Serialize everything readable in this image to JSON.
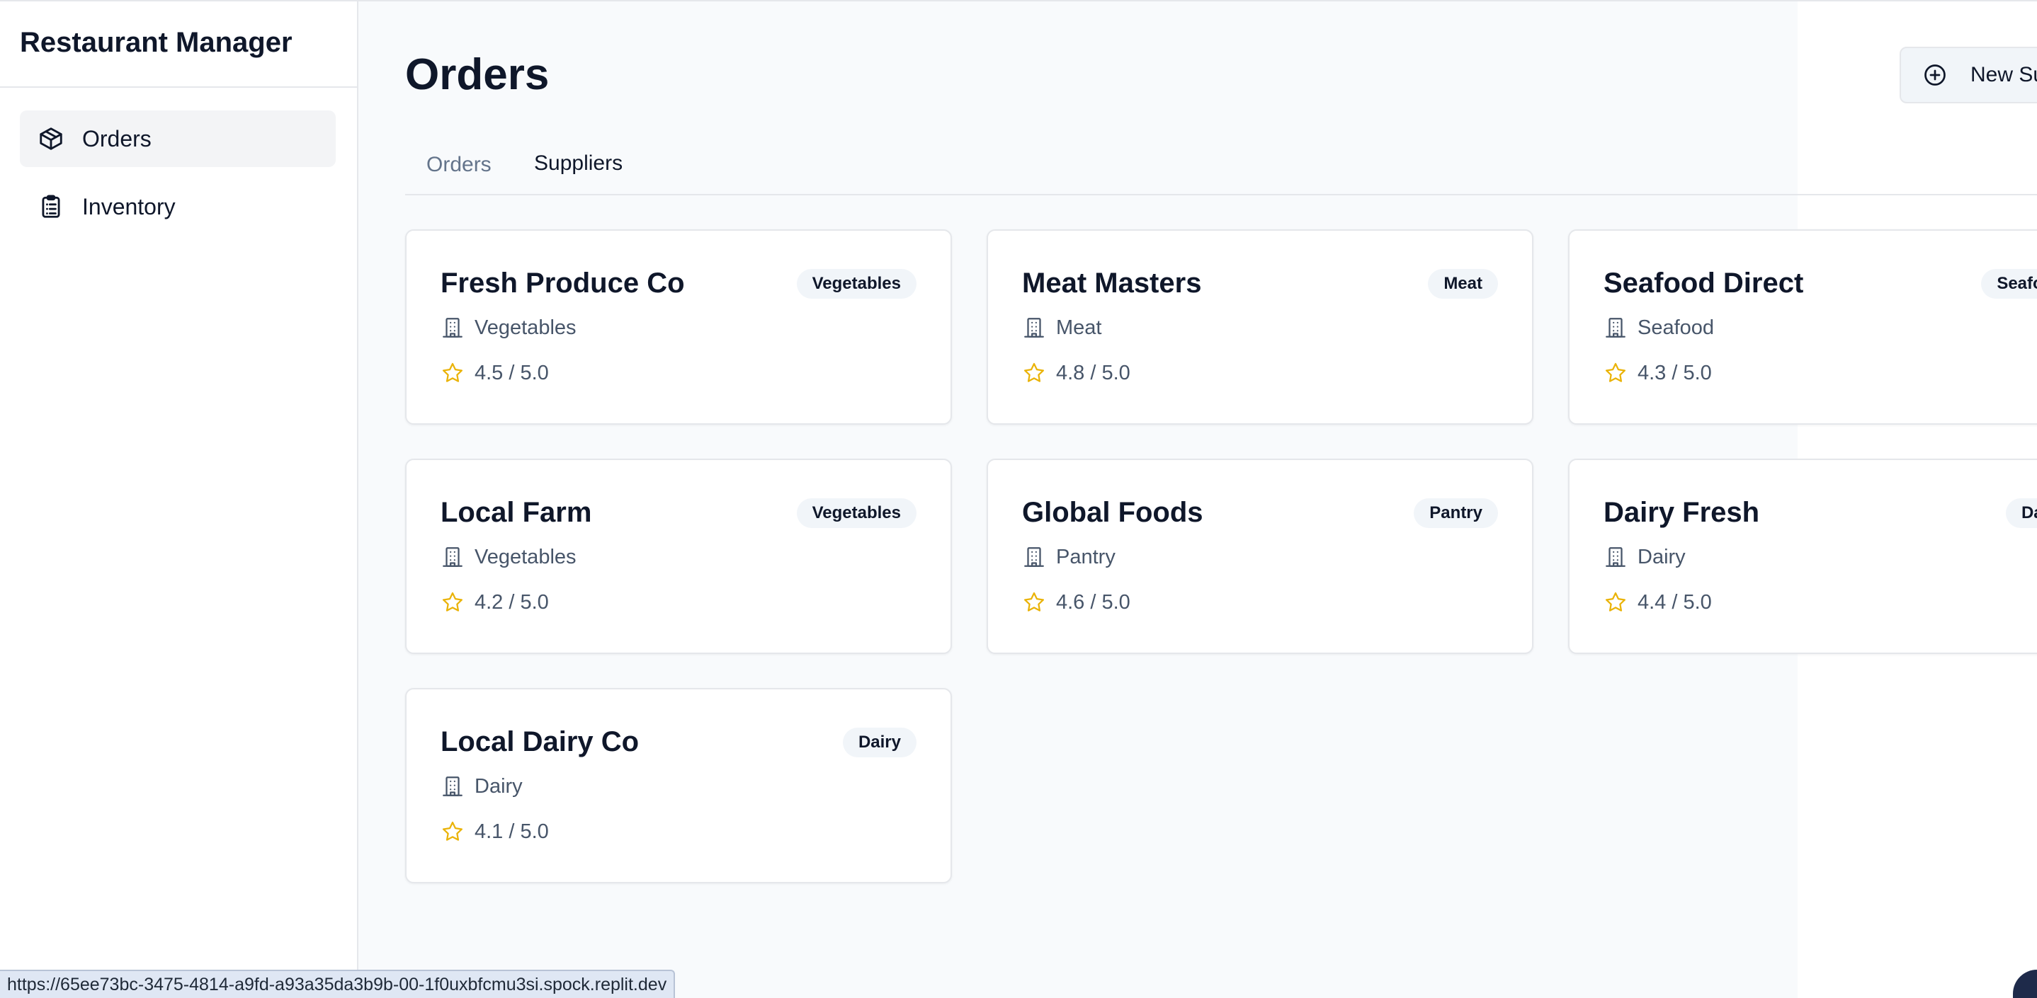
{
  "app": {
    "title": "Restaurant Manager"
  },
  "sidebar": {
    "items": [
      {
        "label": "Orders",
        "icon": "package-icon",
        "active": true
      },
      {
        "label": "Inventory",
        "icon": "clipboard-list-icon",
        "active": false
      }
    ]
  },
  "header": {
    "title": "Orders",
    "new_supplier_label": "New Supplier"
  },
  "tabs": [
    {
      "label": "Orders",
      "active": false
    },
    {
      "label": "Suppliers",
      "active": true
    }
  ],
  "suppliers": [
    {
      "name": "Fresh Produce Co",
      "badge": "Vegetables",
      "category": "Vegetables",
      "rating": "4.5 / 5.0"
    },
    {
      "name": "Meat Masters",
      "badge": "Meat",
      "category": "Meat",
      "rating": "4.8 / 5.0"
    },
    {
      "name": "Seafood Direct",
      "badge": "Seafood",
      "category": "Seafood",
      "rating": "4.3 / 5.0"
    },
    {
      "name": "Local Farm",
      "badge": "Vegetables",
      "category": "Vegetables",
      "rating": "4.2 / 5.0"
    },
    {
      "name": "Global Foods",
      "badge": "Pantry",
      "category": "Pantry",
      "rating": "4.6 / 5.0"
    },
    {
      "name": "Dairy Fresh",
      "badge": "Dairy",
      "category": "Dairy",
      "rating": "4.4 / 5.0"
    },
    {
      "name": "Local Dairy Co",
      "badge": "Dairy",
      "category": "Dairy",
      "rating": "4.1 / 5.0"
    }
  ],
  "status_bar": {
    "url": "https://65ee73bc-3475-4814-a9fd-a93a35da3b9b-00-1f0uxbfcmu3si.spock.replit.dev"
  },
  "colors": {
    "star": "#eab308",
    "accent": "#0f172a",
    "muted": "#64748b"
  }
}
